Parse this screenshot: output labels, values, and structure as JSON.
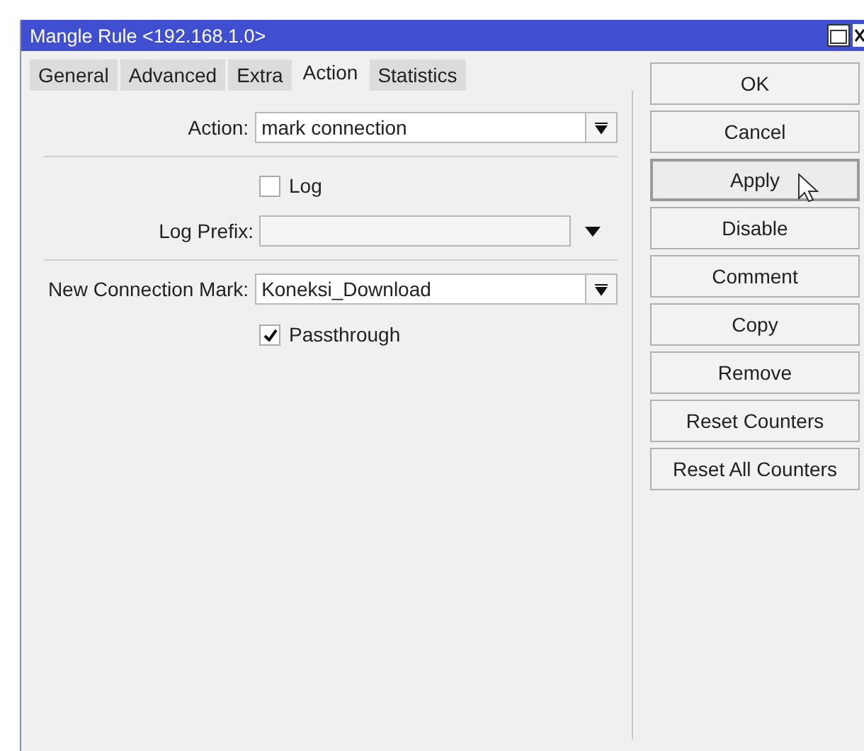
{
  "window": {
    "title": "Mangle Rule <192.168.1.0>"
  },
  "tabs": [
    {
      "label": "General",
      "selected": false
    },
    {
      "label": "Advanced",
      "selected": false
    },
    {
      "label": "Extra",
      "selected": false
    },
    {
      "label": "Action",
      "selected": true
    },
    {
      "label": "Statistics",
      "selected": false
    }
  ],
  "groups": [
    [
      {
        "kind": "select",
        "label": "Action:",
        "value": "mark connection"
      }
    ],
    [
      {
        "kind": "checkbox",
        "label": "Log",
        "checked": false
      },
      {
        "kind": "combo",
        "label": "Log Prefix:"
      }
    ],
    [
      {
        "kind": "select",
        "label": "New Connection Mark:",
        "value": "Koneksi_Download"
      },
      {
        "kind": "checkbox",
        "label": "Passthrough",
        "checked": true
      }
    ]
  ],
  "buttons": [
    {
      "label": "OK",
      "hovered": false
    },
    {
      "label": "Cancel",
      "hovered": false
    },
    {
      "label": "Apply",
      "hovered": true
    },
    {
      "label": "Disable",
      "hovered": false
    },
    {
      "label": "Comment",
      "hovered": false
    },
    {
      "label": "Copy",
      "hovered": false
    },
    {
      "label": "Remove",
      "hovered": false
    },
    {
      "label": "Reset Counters",
      "hovered": false
    },
    {
      "label": "Reset All Counters",
      "hovered": false
    }
  ]
}
